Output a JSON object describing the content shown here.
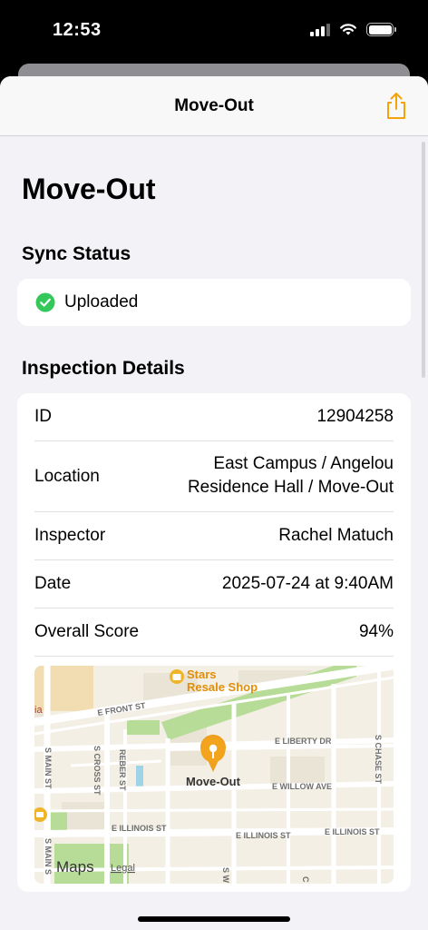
{
  "status_bar": {
    "time": "12:53"
  },
  "nav": {
    "title": "Move-Out"
  },
  "page": {
    "title": "Move-Out"
  },
  "sync": {
    "header": "Sync Status",
    "status": "Uploaded"
  },
  "details": {
    "header": "Inspection Details",
    "rows": [
      {
        "label": "ID",
        "value": "12904258"
      },
      {
        "label": "Location",
        "value_line1": "East Campus / Angelou",
        "value_line2": "Residence Hall / Move-Out"
      },
      {
        "label": "Inspector",
        "value": "Rachel Matuch"
      },
      {
        "label": "Date",
        "value": "2025-07-24 at 9:40AM"
      },
      {
        "label": "Overall Score",
        "value": "94%"
      }
    ]
  },
  "map": {
    "pin_label": "Move-Out",
    "poi_line1": "Stars",
    "poi_line2": "Resale Shop",
    "streets": {
      "front": "E FRONT ST",
      "liberty": "E LIBERTY DR",
      "willow": "E WILLOW AVE",
      "illinois_w": "E ILLINOIS ST",
      "illinois_e": "E ILLINOIS ST",
      "main": "S MAIN ST",
      "main2": "S MAIN S",
      "cross": "S CROSS ST",
      "reber": "REBER ST",
      "chase": "S CHASE ST",
      "s_w": "S W",
      "c": "C",
      "left_fragment": "ia"
    },
    "brand": "Maps",
    "legal": "Legal"
  },
  "colors": {
    "accent": "#f5a30a",
    "success": "#34c759"
  }
}
